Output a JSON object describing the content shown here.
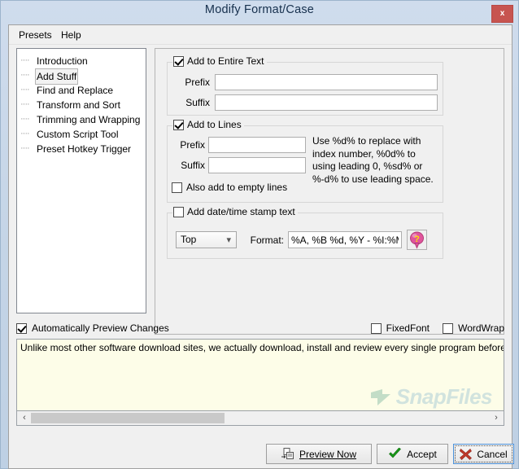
{
  "window": {
    "title": "Modify Format/Case",
    "close_label": "x",
    "close_icon": "close-icon"
  },
  "menubar": {
    "items": [
      {
        "label": "Presets"
      },
      {
        "label": "Help"
      }
    ]
  },
  "tree": {
    "items": [
      {
        "label": "Introduction",
        "selected": false
      },
      {
        "label": "Add Stuff",
        "selected": true
      },
      {
        "label": "Find and Replace",
        "selected": false
      },
      {
        "label": "Transform and Sort",
        "selected": false
      },
      {
        "label": "Trimming and Wrapping",
        "selected": false
      },
      {
        "label": "Custom Script Tool",
        "selected": false
      },
      {
        "label": "Preset Hotkey Trigger",
        "selected": false
      }
    ]
  },
  "entire_text_group": {
    "title": "Add to Entire Text",
    "checked": true,
    "prefix_label": "Prefix",
    "prefix_value": "",
    "suffix_label": "Suffix",
    "suffix_value": ""
  },
  "lines_group": {
    "title": "Add to Lines",
    "checked": true,
    "prefix_label": "Prefix",
    "prefix_value": "",
    "suffix_label": "Suffix",
    "suffix_value": "",
    "hint": "Use %d% to replace with index number, %0d% to using leading 0, %sd% or %-d% to use leading space.",
    "empty_lines_label": "Also add to empty lines",
    "empty_lines_checked": false
  },
  "datetime_group": {
    "title": "Add date/time stamp text",
    "checked": false,
    "position_value": "Top",
    "position_chevron": "chevron-down-icon",
    "format_label": "Format:",
    "format_value": "%A, %B %d, %Y - %I:%M %p",
    "help_icon": "help-balloon-icon",
    "help_glyph": "?"
  },
  "preview_options": {
    "auto_preview_label": "Automatically Preview Changes",
    "auto_preview_checked": true,
    "fixed_font_label": "FixedFont",
    "fixed_font_checked": false,
    "word_wrap_label": "WordWrap",
    "word_wrap_checked": false
  },
  "preview": {
    "text": "Unlike most other software download sites, we actually download, install and review every single program before it is listed on the sit",
    "watermark_text": "SnapFiles",
    "watermark_icon": "snapfiles-logo-icon"
  },
  "scrollbar": {
    "left_arrow": "‹",
    "right_arrow": "›"
  },
  "footer": {
    "preview_now_label": "Preview Now",
    "preview_now_icon": "copy-page-icon",
    "accept_label": "Accept",
    "accept_icon": "green-check-icon",
    "cancel_label": "Cancel",
    "cancel_icon": "red-x-icon"
  },
  "colors": {
    "titlebar": "#c4d4e6",
    "close_button": "#c75450",
    "preview_background": "#fdfde8",
    "accept_check": "#1a9a1a",
    "cancel_x": "#c0392b",
    "watermark": "#9cc4d4",
    "focus_border": "#4a90d9"
  }
}
